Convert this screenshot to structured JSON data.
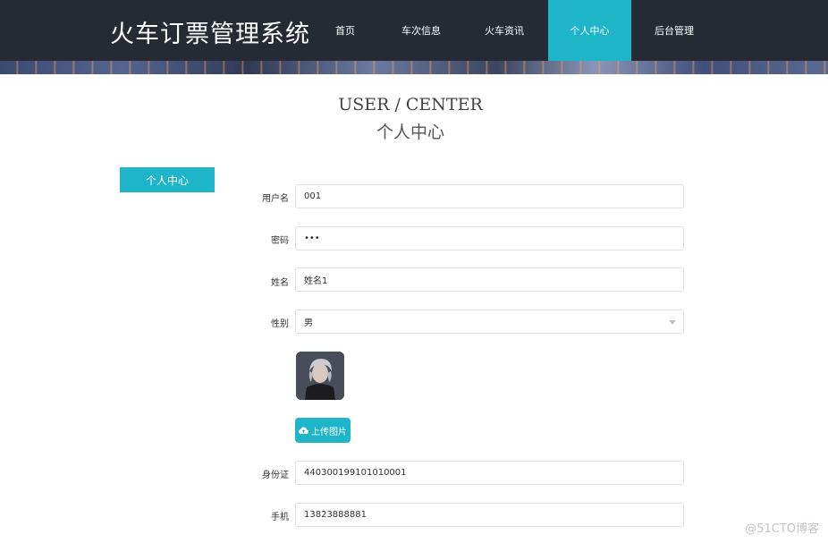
{
  "header": {
    "brand": "火车订票管理系统",
    "nav": [
      {
        "label": "首页",
        "active": false
      },
      {
        "label": "车次信息",
        "active": false
      },
      {
        "label": "火车资讯",
        "active": false
      },
      {
        "label": "个人中心",
        "active": true
      },
      {
        "label": "后台管理",
        "active": false
      }
    ]
  },
  "page": {
    "title_en": "USER / CENTER",
    "title_cn": "个人中心"
  },
  "sidebar": {
    "items": [
      {
        "label": "个人中心",
        "active": true
      }
    ]
  },
  "form": {
    "username": {
      "label": "用户名",
      "value": "001"
    },
    "password": {
      "label": "密码",
      "value": "•••"
    },
    "name": {
      "label": "姓名",
      "value": "姓名1"
    },
    "gender": {
      "label": "性别",
      "value": "男"
    },
    "upload_label": "上传图片",
    "id_card": {
      "label": "身份证",
      "value": "440300199101010001"
    },
    "phone": {
      "label": "手机",
      "value": "13823888881"
    }
  },
  "watermark": "@51CTO博客",
  "colors": {
    "accent": "#1fb5c8",
    "topbar": "#252a34"
  },
  "icons": {
    "upload": "cloud-upload-icon",
    "dropdown": "chevron-down-icon"
  }
}
